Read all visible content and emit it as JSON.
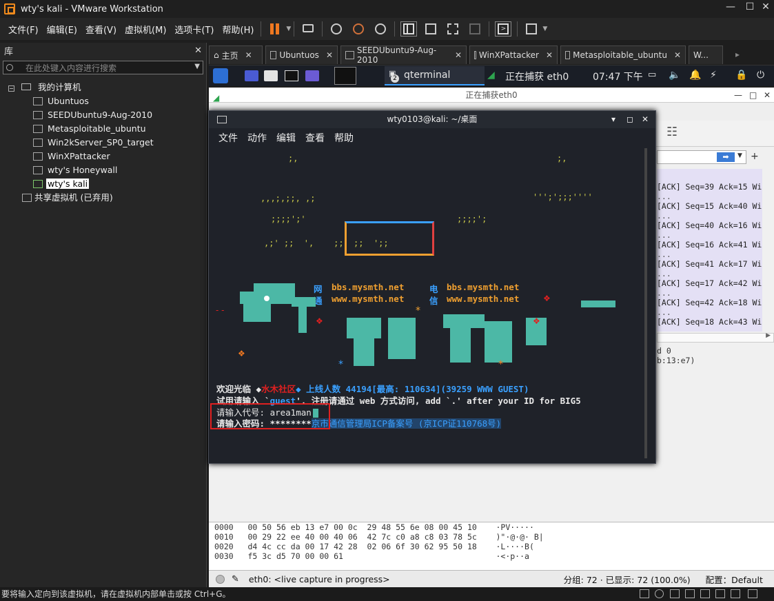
{
  "vmware": {
    "title": "wty's kali - VMware Workstation",
    "menu": [
      "文件(F)",
      "编辑(E)",
      "查看(V)",
      "虚拟机(M)",
      "选项卡(T)",
      "帮助(H)"
    ],
    "status_hint": "要将输入定向到该虚拟机，请在虚拟机内部单击或按 Ctrl+G。"
  },
  "library": {
    "header": "库",
    "search_placeholder": "在此处键入内容进行搜索",
    "root": "我的计算机",
    "vms": [
      "Ubuntuos",
      "SEEDUbuntu9-Aug-2010",
      "Metasploitable_ubuntu",
      "Win2kServer_SP0_target",
      "WinXPattacker",
      "wty's Honeywall",
      "wty's kali"
    ],
    "shared": "共享虚拟机 (已弃用)"
  },
  "tabs": [
    "主页",
    "Ubuntuos",
    "SEEDUbuntu9-Aug-2010",
    "WinXPattacker",
    "Metasploitable_ubuntu",
    "W..."
  ],
  "kali_panel": {
    "task_terminal": "qterminal",
    "task_capture": "正在捕获 eth0",
    "badge": "2",
    "clock": "07:47 下午"
  },
  "wireshark": {
    "title": "正在捕获eth0",
    "packets": [
      "[ACK] Seq=39 Ack=15 Wi",
      "[ACK] Seq=15 Ack=40 Wi",
      "[ACK] Seq=40 Ack=16 Wi",
      "[ACK] Seq=16 Ack=41 Wi",
      "[ACK] Seq=41 Ack=17 Wi",
      "[ACK] Seq=17 Ack=42 Wi",
      "[ACK] Seq=42 Ack=18 Wi",
      "[ACK] Seq=18 Ack=43 Wi"
    ],
    "detail_tail": [
      "d 0",
      "b:13:e7)"
    ],
    "hex_rows": [
      "0000   00 50 56 eb 13 e7 00 0c  29 48 55 6e 08 00 45 10    ·PV·····",
      "0010   00 29 22 ee 40 00 40 06  42 7c c0 a8 c8 03 78 5c    )\"·@·@· B|",
      "0020   d4 4c cc da 00 17 42 28  02 06 6f 30 62 95 50 18    ·L····B(",
      "0030   f5 3c d5 70 00 00 61                                ·<·p··a"
    ],
    "status_iface": "eth0: <live capture in progress>",
    "status_counts": "分组: 72 · 已显示: 72 (100.0%)",
    "status_profile": "配置：Default"
  },
  "terminal": {
    "title": "wty0103@kali: ~/桌面",
    "menu": [
      "文件",
      "动作",
      "编辑",
      "查看",
      "帮助"
    ],
    "bbs_label1": "网",
    "bbs_label2": "通",
    "bbs_label3": "电",
    "bbs_label4": "信",
    "bbs_host1": "bbs.mysmth.net",
    "bbs_www1": "www.mysmth.net",
    "bbs_host2": "bbs.mysmth.net",
    "bbs_www2": "www.mysmth.net",
    "welcome_prefix": "欢迎光临 ◆",
    "welcome_site": "水木社区",
    "welcome_online": "◆ 上线人数 44194[最高: 110634](39259 WWW GUEST)",
    "guest_line_a": "试用请输入 `",
    "guest_word": "guest",
    "guest_line_b": "'. 注册请通过 web 方式访问, add `.' after your ID for BIG5",
    "id_prompt": "请输入代号: ",
    "id_value": "area1man",
    "pw_prompt": "请输入密码: ",
    "pw_value": "********",
    "icp": "京市通信管理局ICP备案号 (京ICP证110768号)"
  },
  "colors": {
    "accent_teal": "#4cb8a6",
    "highlight_red": "#e02020",
    "link_blue": "#3aa0ff"
  }
}
